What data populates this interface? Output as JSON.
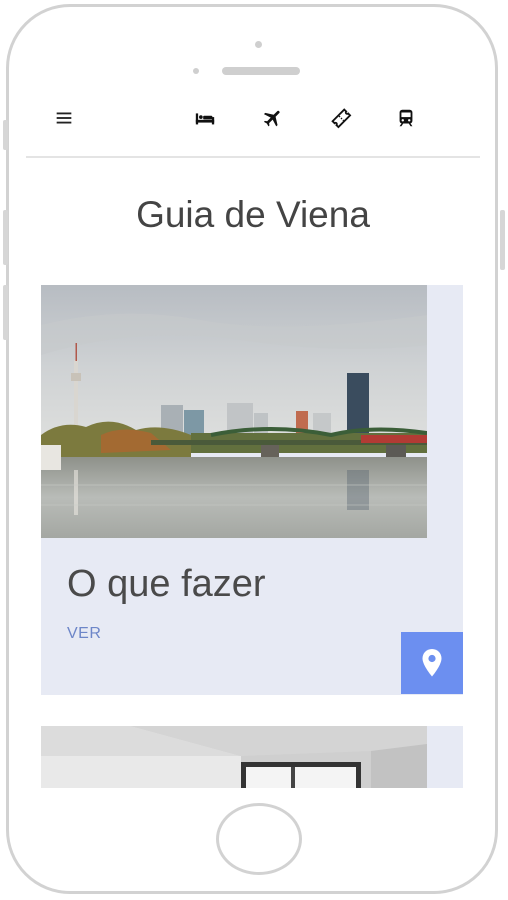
{
  "colors": {
    "accent": "#6c8ff0",
    "card_background": "#e7eaf4",
    "link": "#6d86c8",
    "title_text": "#444444"
  },
  "topbar": {
    "menu_icon": "hamburger-menu-icon",
    "icons": [
      "hotel-bed-icon",
      "airplane-icon",
      "ticket-icon",
      "train-icon"
    ]
  },
  "page": {
    "title": "Guia de Viena"
  },
  "cards": [
    {
      "title": "O que fazer",
      "link_label": "VER",
      "action_icon": "map-pin-icon",
      "image": "vienna-skyline-river-photo"
    },
    {
      "image": "interior-room-photo"
    }
  ]
}
